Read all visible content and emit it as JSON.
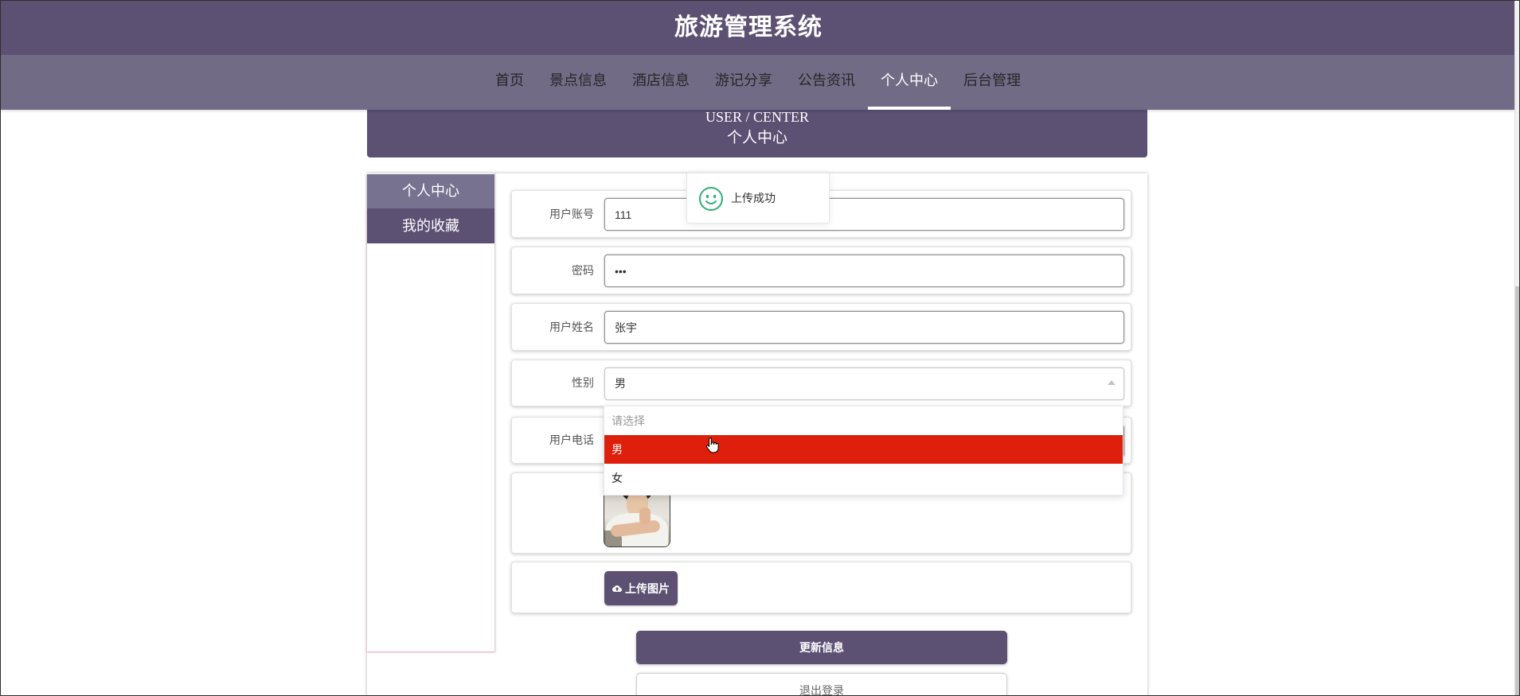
{
  "app": {
    "title": "旅游管理系统"
  },
  "nav": {
    "items": [
      {
        "label": "首页"
      },
      {
        "label": "景点信息"
      },
      {
        "label": "酒店信息"
      },
      {
        "label": "游记分享"
      },
      {
        "label": "公告资讯"
      },
      {
        "label": "个人中心",
        "active": true
      },
      {
        "label": "后台管理"
      }
    ]
  },
  "banner": {
    "title_en": "USER / CENTER",
    "title_cn": "个人中心"
  },
  "sidebar": {
    "items": [
      {
        "label": "个人中心",
        "active": true
      },
      {
        "label": "我的收藏"
      }
    ]
  },
  "form": {
    "account": {
      "label": "用户账号",
      "value": "111"
    },
    "password": {
      "label": "密码",
      "value": "•••"
    },
    "name": {
      "label": "用户姓名",
      "value": "张宇"
    },
    "gender": {
      "label": "性别",
      "value": "男",
      "open": true,
      "options": [
        {
          "label": "请选择",
          "placeholder": true
        },
        {
          "label": "男",
          "highlighted": true
        },
        {
          "label": "女"
        }
      ]
    },
    "phone": {
      "label": "用户电话"
    },
    "photo": {
      "icon": "user-avatar-photo"
    },
    "upload": {
      "label": "上传图片",
      "icon": "cloud-upload-icon"
    }
  },
  "actions": {
    "update": "更新信息",
    "logout": "退出登录"
  },
  "toast": {
    "message": "上传成功",
    "icon": "smile-icon"
  },
  "colors": {
    "primary": "#5c5073",
    "nav": "#716b86",
    "sidebar_active": "#787291",
    "option_highlight": "#de1f0b",
    "success": "#2fae7a"
  }
}
